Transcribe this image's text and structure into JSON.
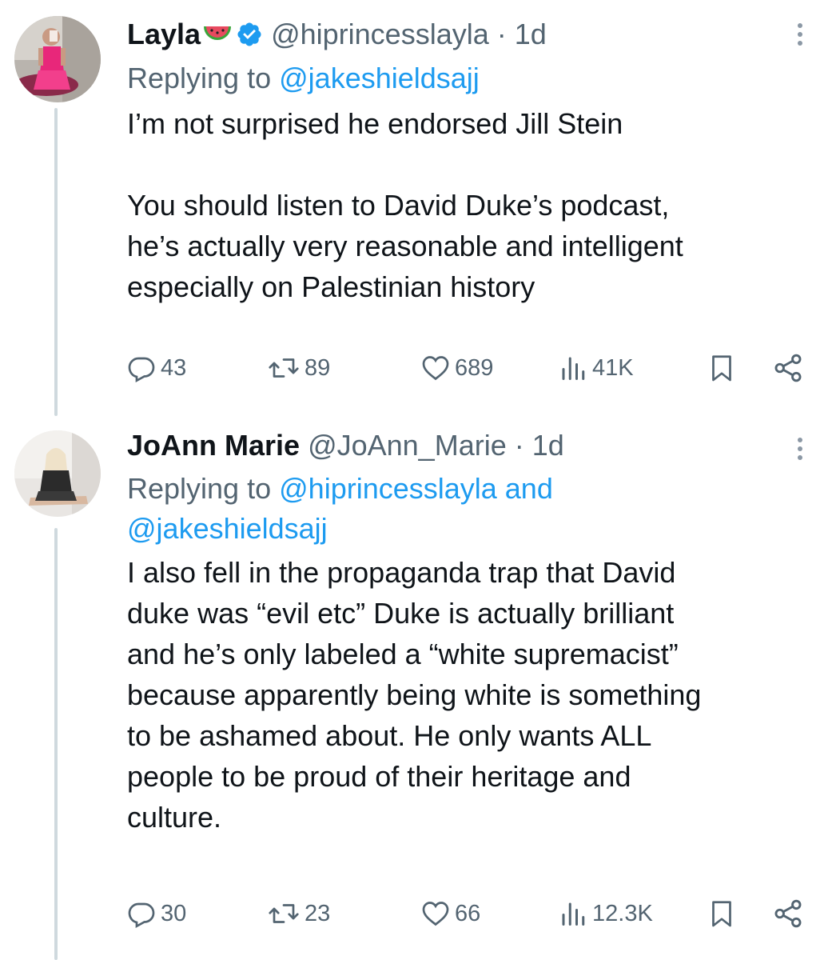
{
  "tweets": [
    {
      "name": "Layla",
      "name_emoji": "watermelon",
      "verified": true,
      "handle": "@hiprincesslayla",
      "separator": "·",
      "time": "1d",
      "replying_prefix": "Replying to",
      "replying_mentions": "@jakeshieldsajj",
      "replying_mentions_line2": "",
      "body_lines": [
        "I’m not surprised he endorsed Jill Stein",
        "",
        "You should listen to David Duke’s podcast,",
        "he’s actually very reasonable and intelligent",
        "especially on Palestinian history"
      ],
      "stats": {
        "replies": "43",
        "retweets": "89",
        "likes": "689",
        "views": "41K"
      }
    },
    {
      "name": "JoAnn Marie",
      "verified": false,
      "handle": "@JoAnn_Marie",
      "separator": "·",
      "time": "1d",
      "replying_prefix": "Replying to",
      "replying_mentions": "@hiprincesslayla and",
      "replying_mentions_line2": "@jakeshieldsajj",
      "body_lines": [
        "I also fell in the propaganda trap that David",
        "duke was “evil etc” Duke is actually brilliant",
        "and he’s only labeled a “white supremacist”",
        "because apparently being white is something",
        "to be ashamed about. He only wants ALL",
        "people to be proud of their heritage and",
        "culture."
      ],
      "stats": {
        "replies": "30",
        "retweets": "23",
        "likes": "66",
        "views": "12.3K"
      }
    }
  ],
  "icons": {
    "reply": "reply-icon",
    "retweet": "retweet-icon",
    "like": "heart-icon",
    "views": "views-icon",
    "bookmark": "bookmark-icon",
    "share": "share-icon",
    "more": "more-icon",
    "verified": "verified-badge-icon"
  },
  "colors": {
    "text": "#0f1419",
    "secondary": "#536471",
    "link": "#1d9bf0",
    "verified": "#1d9bf0",
    "thread_line": "#cfd9de"
  }
}
